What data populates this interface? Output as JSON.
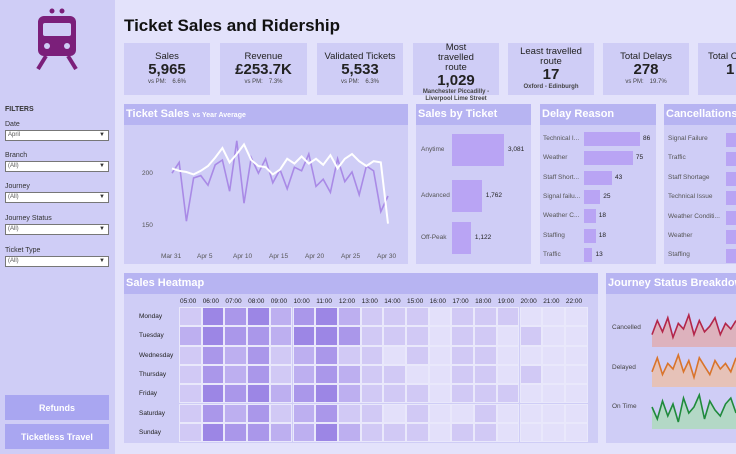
{
  "page": {
    "title": "Ticket Sales and Ridership"
  },
  "sidebar": {
    "filters_title": "FILTERS",
    "filters": [
      {
        "label": "Date",
        "value": "April"
      },
      {
        "label": "Branch",
        "value": "(All)"
      },
      {
        "label": "Journey",
        "value": "(All)"
      },
      {
        "label": "Journey Status",
        "value": "(All)"
      },
      {
        "label": "Ticket Type",
        "value": "(All)"
      }
    ],
    "buttons": [
      "Refunds",
      "Ticketless Travel"
    ]
  },
  "kpis": [
    {
      "label": "Sales",
      "value": "5,965",
      "sub_label": "vs PM:",
      "sub_value": "6.6%"
    },
    {
      "label": "Revenue",
      "value": "£253.7K",
      "sub_label": "vs PM:",
      "sub_value": "7.3%"
    },
    {
      "label": "Validated Tickets",
      "value": "5,533",
      "sub_label": "vs PM:",
      "sub_value": "6.3%"
    },
    {
      "label": "Most travelled route",
      "value": "1,029",
      "sub_label": "Manchester Piccadilly - Liverpool Lime Street",
      "sub_value": ""
    },
    {
      "label": "Least travelled route",
      "value": "17",
      "sub_label": "Oxford - Edinburgh",
      "sub_value": ""
    },
    {
      "label": "Total Delays",
      "value": "278",
      "sub_label": "vs PM:",
      "sub_value": "19.7%"
    },
    {
      "label": "Total C",
      "value": "1",
      "sub_label": "",
      "sub_value": ""
    }
  ],
  "ticket_sales": {
    "title": "Ticket Sales",
    "subtitle": "vs Year Average",
    "y_ticks": [
      "200",
      "150"
    ],
    "x_ticks": [
      "Mar 31",
      "Apr 5",
      "Apr 10",
      "Apr 15",
      "Apr 20",
      "Apr 25",
      "Apr 30"
    ]
  },
  "sales_by_ticket": {
    "title": "Sales by Ticket",
    "items": [
      {
        "label": "Anytime",
        "value": "3,081"
      },
      {
        "label": "Advanced",
        "value": "1,762"
      },
      {
        "label": "Off-Peak",
        "value": "1,122"
      }
    ]
  },
  "delay_reason": {
    "title": "Delay Reason",
    "items": [
      {
        "label": "Technical I...",
        "value": "86"
      },
      {
        "label": "Weather",
        "value": "75"
      },
      {
        "label": "Staff Short...",
        "value": "43"
      },
      {
        "label": "Signal failu...",
        "value": "25"
      },
      {
        "label": "Weather C...",
        "value": "18"
      },
      {
        "label": "Staffing",
        "value": "18"
      },
      {
        "label": "Traffic",
        "value": "13"
      }
    ]
  },
  "cancellations": {
    "title": "Cancellations",
    "items": [
      "Signal Failure",
      "Traffic",
      "Staff Shortage",
      "Technical Issue",
      "Weather Conditi...",
      "Weather",
      "Staffing"
    ]
  },
  "heatmap": {
    "title": "Sales Heatmap",
    "hours": [
      "05:00",
      "06:00",
      "07:00",
      "08:00",
      "09:00",
      "10:00",
      "11:00",
      "12:00",
      "13:00",
      "14:00",
      "15:00",
      "16:00",
      "17:00",
      "18:00",
      "19:00",
      "20:00",
      "21:00",
      "22:00"
    ],
    "days": [
      "Monday",
      "Tuesday",
      "Wednesday",
      "Thursday",
      "Friday",
      "Saturday",
      "Sunday"
    ]
  },
  "journey_status": {
    "title": "Journey Status Breakdown",
    "labels": [
      "Cancelled",
      "Delayed",
      "On Time"
    ]
  },
  "chart_data": [
    {
      "type": "line",
      "title": "Ticket Sales",
      "subtitle": "vs Year Average",
      "x": [
        "Mar 31",
        "Apr 1",
        "Apr 2",
        "Apr 3",
        "Apr 4",
        "Apr 5",
        "Apr 6",
        "Apr 7",
        "Apr 8",
        "Apr 9",
        "Apr 10",
        "Apr 11",
        "Apr 12",
        "Apr 13",
        "Apr 14",
        "Apr 15",
        "Apr 16",
        "Apr 17",
        "Apr 18",
        "Apr 19",
        "Apr 20",
        "Apr 21",
        "Apr 22",
        "Apr 23",
        "Apr 24",
        "Apr 25",
        "Apr 26",
        "Apr 27",
        "Apr 28",
        "Apr 29",
        "Apr 30"
      ],
      "series": [
        {
          "values": [
            199,
            208,
            159,
            195,
            197,
            189,
            206,
            210,
            184,
            226,
            174,
            212,
            199,
            211,
            191,
            202,
            186,
            204,
            201,
            215,
            188,
            194,
            183,
            211,
            192,
            200,
            181,
            205,
            201,
            167,
            180
          ]
        },
        {
          "values": [
            203,
            201,
            200,
            198,
            201,
            205,
            212,
            220,
            208,
            215,
            223,
            210,
            205,
            204,
            198,
            202,
            211,
            207,
            213,
            207,
            211,
            206,
            214,
            203,
            211,
            215,
            209,
            205,
            209,
            208,
            157
          ]
        }
      ],
      "ylim": [
        140,
        235
      ]
    },
    {
      "type": "bar",
      "title": "Sales by Ticket",
      "categories": [
        "Anytime",
        "Advanced",
        "Off-Peak"
      ],
      "values": [
        3081,
        1762,
        1122
      ]
    },
    {
      "type": "bar",
      "title": "Delay Reason",
      "categories": [
        "Technical I...",
        "Weather",
        "Staff Short...",
        "Signal failu...",
        "Weather C...",
        "Staffing",
        "Traffic"
      ],
      "values": [
        86,
        75,
        43,
        25,
        18,
        18,
        13
      ]
    },
    {
      "type": "heatmap",
      "title": "Sales Heatmap",
      "x": [
        "05:00",
        "06:00",
        "07:00",
        "08:00",
        "09:00",
        "10:00",
        "11:00",
        "12:00",
        "13:00",
        "14:00",
        "15:00",
        "16:00",
        "17:00",
        "18:00",
        "19:00",
        "20:00",
        "21:00",
        "22:00"
      ],
      "y": [
        "Monday",
        "Tuesday",
        "Wednesday",
        "Thursday",
        "Friday",
        "Saturday",
        "Sunday"
      ],
      "values": [
        [
          2,
          5,
          4,
          5,
          3,
          4,
          5,
          3,
          2,
          2,
          2,
          1,
          2,
          2,
          2,
          1,
          1,
          1
        ],
        [
          3,
          5,
          4,
          4,
          3,
          6,
          6,
          4,
          2,
          2,
          2,
          1,
          2,
          2,
          1,
          2,
          1,
          1
        ],
        [
          2,
          4,
          3,
          4,
          2,
          3,
          4,
          2,
          2,
          1,
          2,
          1,
          2,
          2,
          1,
          1,
          1,
          1
        ],
        [
          2,
          4,
          3,
          4,
          2,
          3,
          4,
          3,
          2,
          2,
          1,
          1,
          2,
          2,
          1,
          2,
          1,
          1
        ],
        [
          2,
          6,
          4,
          5,
          3,
          4,
          5,
          3,
          2,
          2,
          2,
          1,
          2,
          2,
          2,
          1,
          1,
          1
        ],
        [
          2,
          4,
          3,
          4,
          2,
          3,
          4,
          2,
          2,
          1,
          2,
          1,
          1,
          2,
          1,
          1,
          1,
          1
        ],
        [
          2,
          5,
          4,
          4,
          3,
          3,
          6,
          3,
          2,
          2,
          2,
          1,
          2,
          2,
          1,
          1,
          1,
          1
        ]
      ]
    },
    {
      "type": "line",
      "title": "Journey Status Breakdown",
      "series": [
        {
          "name": "Cancelled",
          "values": [
            3,
            8,
            4,
            9,
            2,
            7,
            5,
            10,
            3,
            8,
            4,
            6,
            9,
            3,
            7,
            5,
            8
          ]
        },
        {
          "name": "Delayed",
          "values": [
            4,
            9,
            3,
            7,
            5,
            10,
            4,
            8,
            2,
            9,
            6,
            3,
            8,
            5,
            7,
            4,
            9
          ]
        },
        {
          "name": "On Time",
          "values": [
            6,
            2,
            8,
            3,
            7,
            1,
            9,
            4,
            6,
            10,
            2,
            8,
            5,
            3,
            7,
            9,
            4
          ]
        }
      ]
    }
  ],
  "colors": {
    "bg": "#e3e2fb",
    "panel": "#cfcdf6",
    "accent": "#b7b4f2",
    "logo": "#7b1f7a",
    "bar": "#b9a4f4"
  }
}
